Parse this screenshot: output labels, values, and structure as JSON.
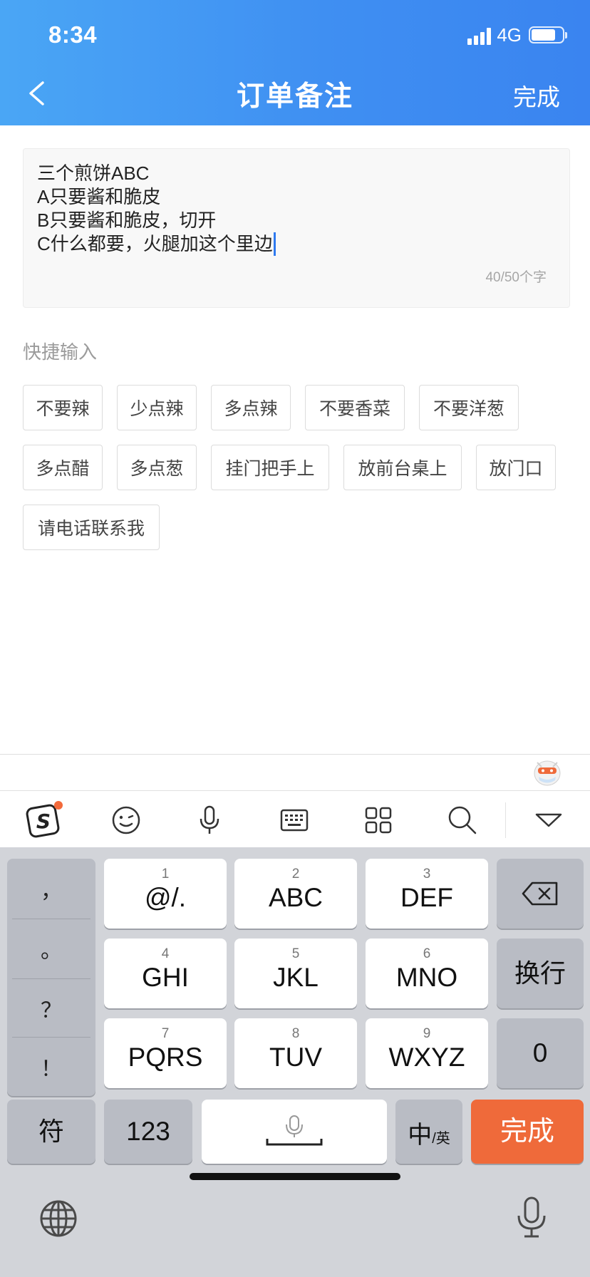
{
  "status_bar": {
    "time": "8:34",
    "network": "4G"
  },
  "nav": {
    "title": "订单备注",
    "done_label": "完成"
  },
  "note": {
    "lines": [
      "三个煎饼ABC",
      "A只要酱和脆皮",
      "B只要酱和脆皮，切开",
      "C什么都要，火腿加这个里边"
    ],
    "counter": "40/50个字"
  },
  "quick_input": {
    "title": "快捷输入",
    "tags": [
      "不要辣",
      "少点辣",
      "多点辣",
      "不要香菜",
      "不要洋葱",
      "多点醋",
      "多点葱",
      "挂门把手上",
      "放前台桌上",
      "放门口",
      "请电话联系我"
    ]
  },
  "ime_toolbar": {
    "icons": [
      "sogou-logo-icon",
      "emoji-icon",
      "microphone-icon",
      "keyboard-icon",
      "apps-grid-icon",
      "search-icon",
      "collapse-keyboard-icon"
    ],
    "notification_color": "#f36a3b"
  },
  "keyboard": {
    "punctuation": [
      "，",
      "。",
      "？",
      "！"
    ],
    "t9_keys": [
      {
        "num": "1",
        "main": "@/."
      },
      {
        "num": "2",
        "main": "ABC"
      },
      {
        "num": "3",
        "main": "DEF"
      },
      {
        "num": "4",
        "main": "GHI"
      },
      {
        "num": "5",
        "main": "JKL"
      },
      {
        "num": "6",
        "main": "MNO"
      },
      {
        "num": "7",
        "main": "PQRS"
      },
      {
        "num": "8",
        "main": "TUV"
      },
      {
        "num": "9",
        "main": "WXYZ"
      }
    ],
    "newline_label": "换行",
    "zero_label": "0",
    "symbol_label": "符",
    "numbers_label": "123",
    "lang_main": "中",
    "lang_sub": "/英",
    "done_label": "完成",
    "done_color": "#ef6a3a"
  },
  "bottom": {
    "icons": [
      "globe-icon",
      "dictation-icon"
    ]
  },
  "colors": {
    "header_gradient_start": "#4aa6f5",
    "header_gradient_end": "#3a84f0",
    "caret": "#2f7af0"
  }
}
